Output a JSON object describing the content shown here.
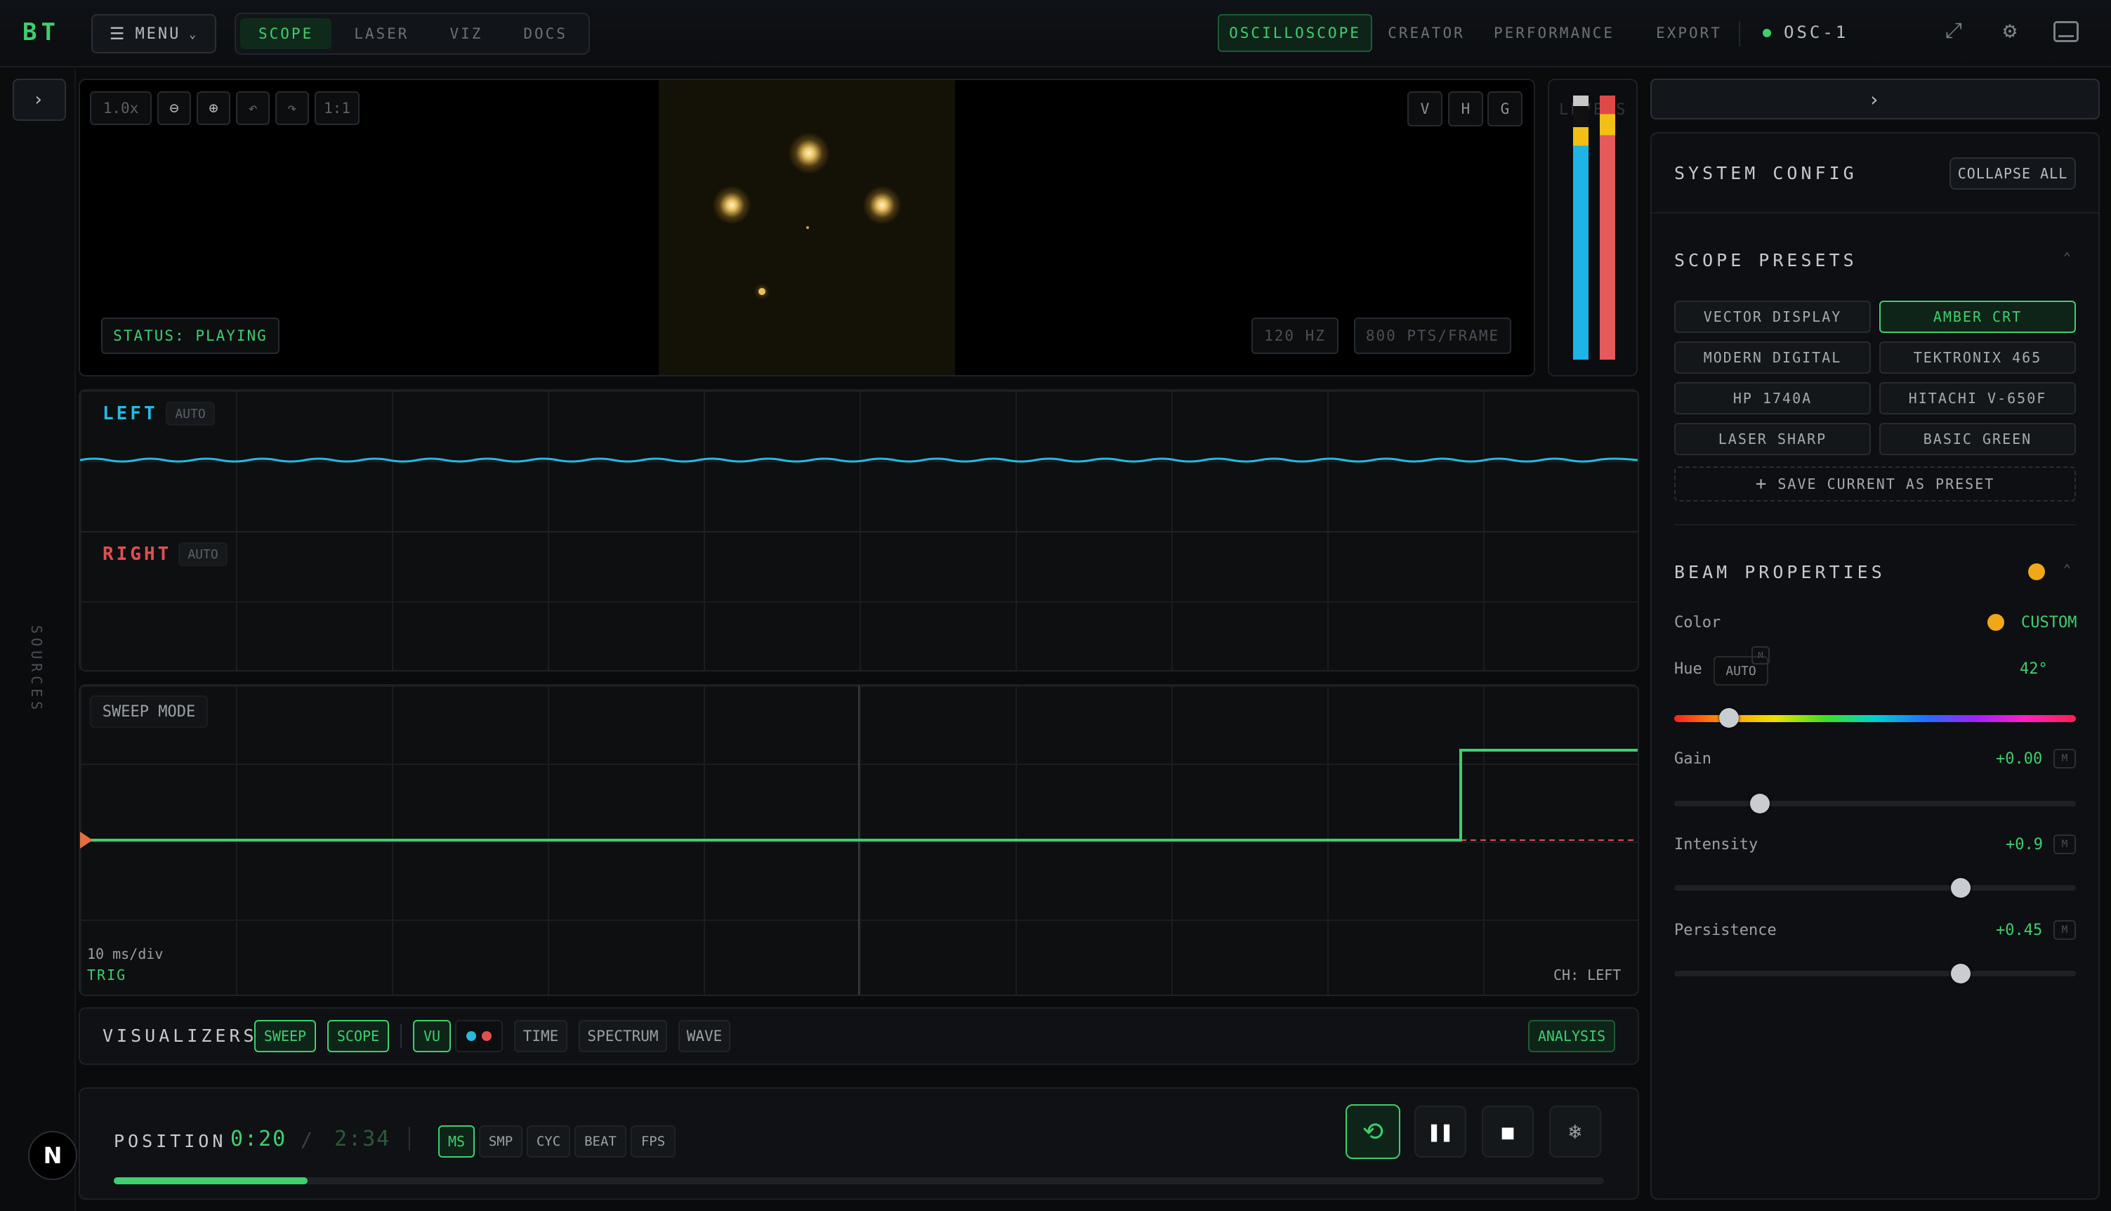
{
  "app": {
    "logo": "BT",
    "menu_label": "MENU"
  },
  "top_tabs": [
    {
      "label": "SCOPE"
    },
    {
      "label": "LASER"
    },
    {
      "label": "VIZ"
    },
    {
      "label": "DOCS"
    }
  ],
  "right_nav": [
    {
      "label": "OSCILLOSCOPE"
    },
    {
      "label": "CREATOR"
    },
    {
      "label": "PERFORMANCE"
    },
    {
      "label": "EXPORT"
    }
  ],
  "device": {
    "name": "OSC-1"
  },
  "sidebar_left": {
    "label": "SOURCES",
    "logo": "N"
  },
  "viewer": {
    "zoom": "1.0x",
    "reset": "1:1",
    "axes": [
      "V",
      "H",
      "G"
    ],
    "status": "STATUS: PLAYING",
    "rate": "120 HZ",
    "points": "800 PTS/FRAME",
    "levels_label": "LEVELS"
  },
  "channels": {
    "left": {
      "name": "LEFT",
      "mode": "AUTO"
    },
    "right": {
      "name": "RIGHT",
      "mode": "AUTO"
    }
  },
  "sweep": {
    "title": "SWEEP MODE",
    "timebase": "10 ms/div",
    "trig": "TRIG",
    "channel": "CH: LEFT"
  },
  "visualizers": {
    "title": "VISUALIZERS",
    "items": [
      "SWEEP",
      "SCOPE",
      "VU",
      "TIME",
      "SPECTRUM",
      "WAVE"
    ],
    "analysis": "ANALYSIS"
  },
  "transport": {
    "position_label": "POSITION",
    "current": "0:20",
    "separator": "/",
    "total": "2:34",
    "units": [
      "MS",
      "SMP",
      "CYC",
      "BEAT",
      "FPS"
    ],
    "progress": 0.13
  },
  "config": {
    "title": "SYSTEM CONFIG",
    "collapse_all": "COLLAPSE ALL",
    "presets_title": "SCOPE PRESETS",
    "presets": [
      "VECTOR DISPLAY",
      "AMBER CRT",
      "MODERN DIGITAL",
      "TEKTRONIX 465",
      "HP 1740A",
      "HITACHI V-650F",
      "LASER SHARP",
      "BASIC GREEN"
    ],
    "active_preset": "AMBER CRT",
    "save_preset": "SAVE CURRENT AS PRESET",
    "beam_title": "BEAM PROPERTIES",
    "color_label": "Color",
    "color_value": "CUSTOM",
    "hue_label": "Hue",
    "hue_auto": "AUTO",
    "hue_value": "42°",
    "gain_label": "Gain",
    "gain_value": "+0.00",
    "intensity_label": "Intensity",
    "intensity_value": "+0.9",
    "persistence_label": "Persistence",
    "persistence_value": "+0.45",
    "m_label": "M",
    "beam_color": "#f0a818",
    "accent": "#3ecf6e"
  }
}
